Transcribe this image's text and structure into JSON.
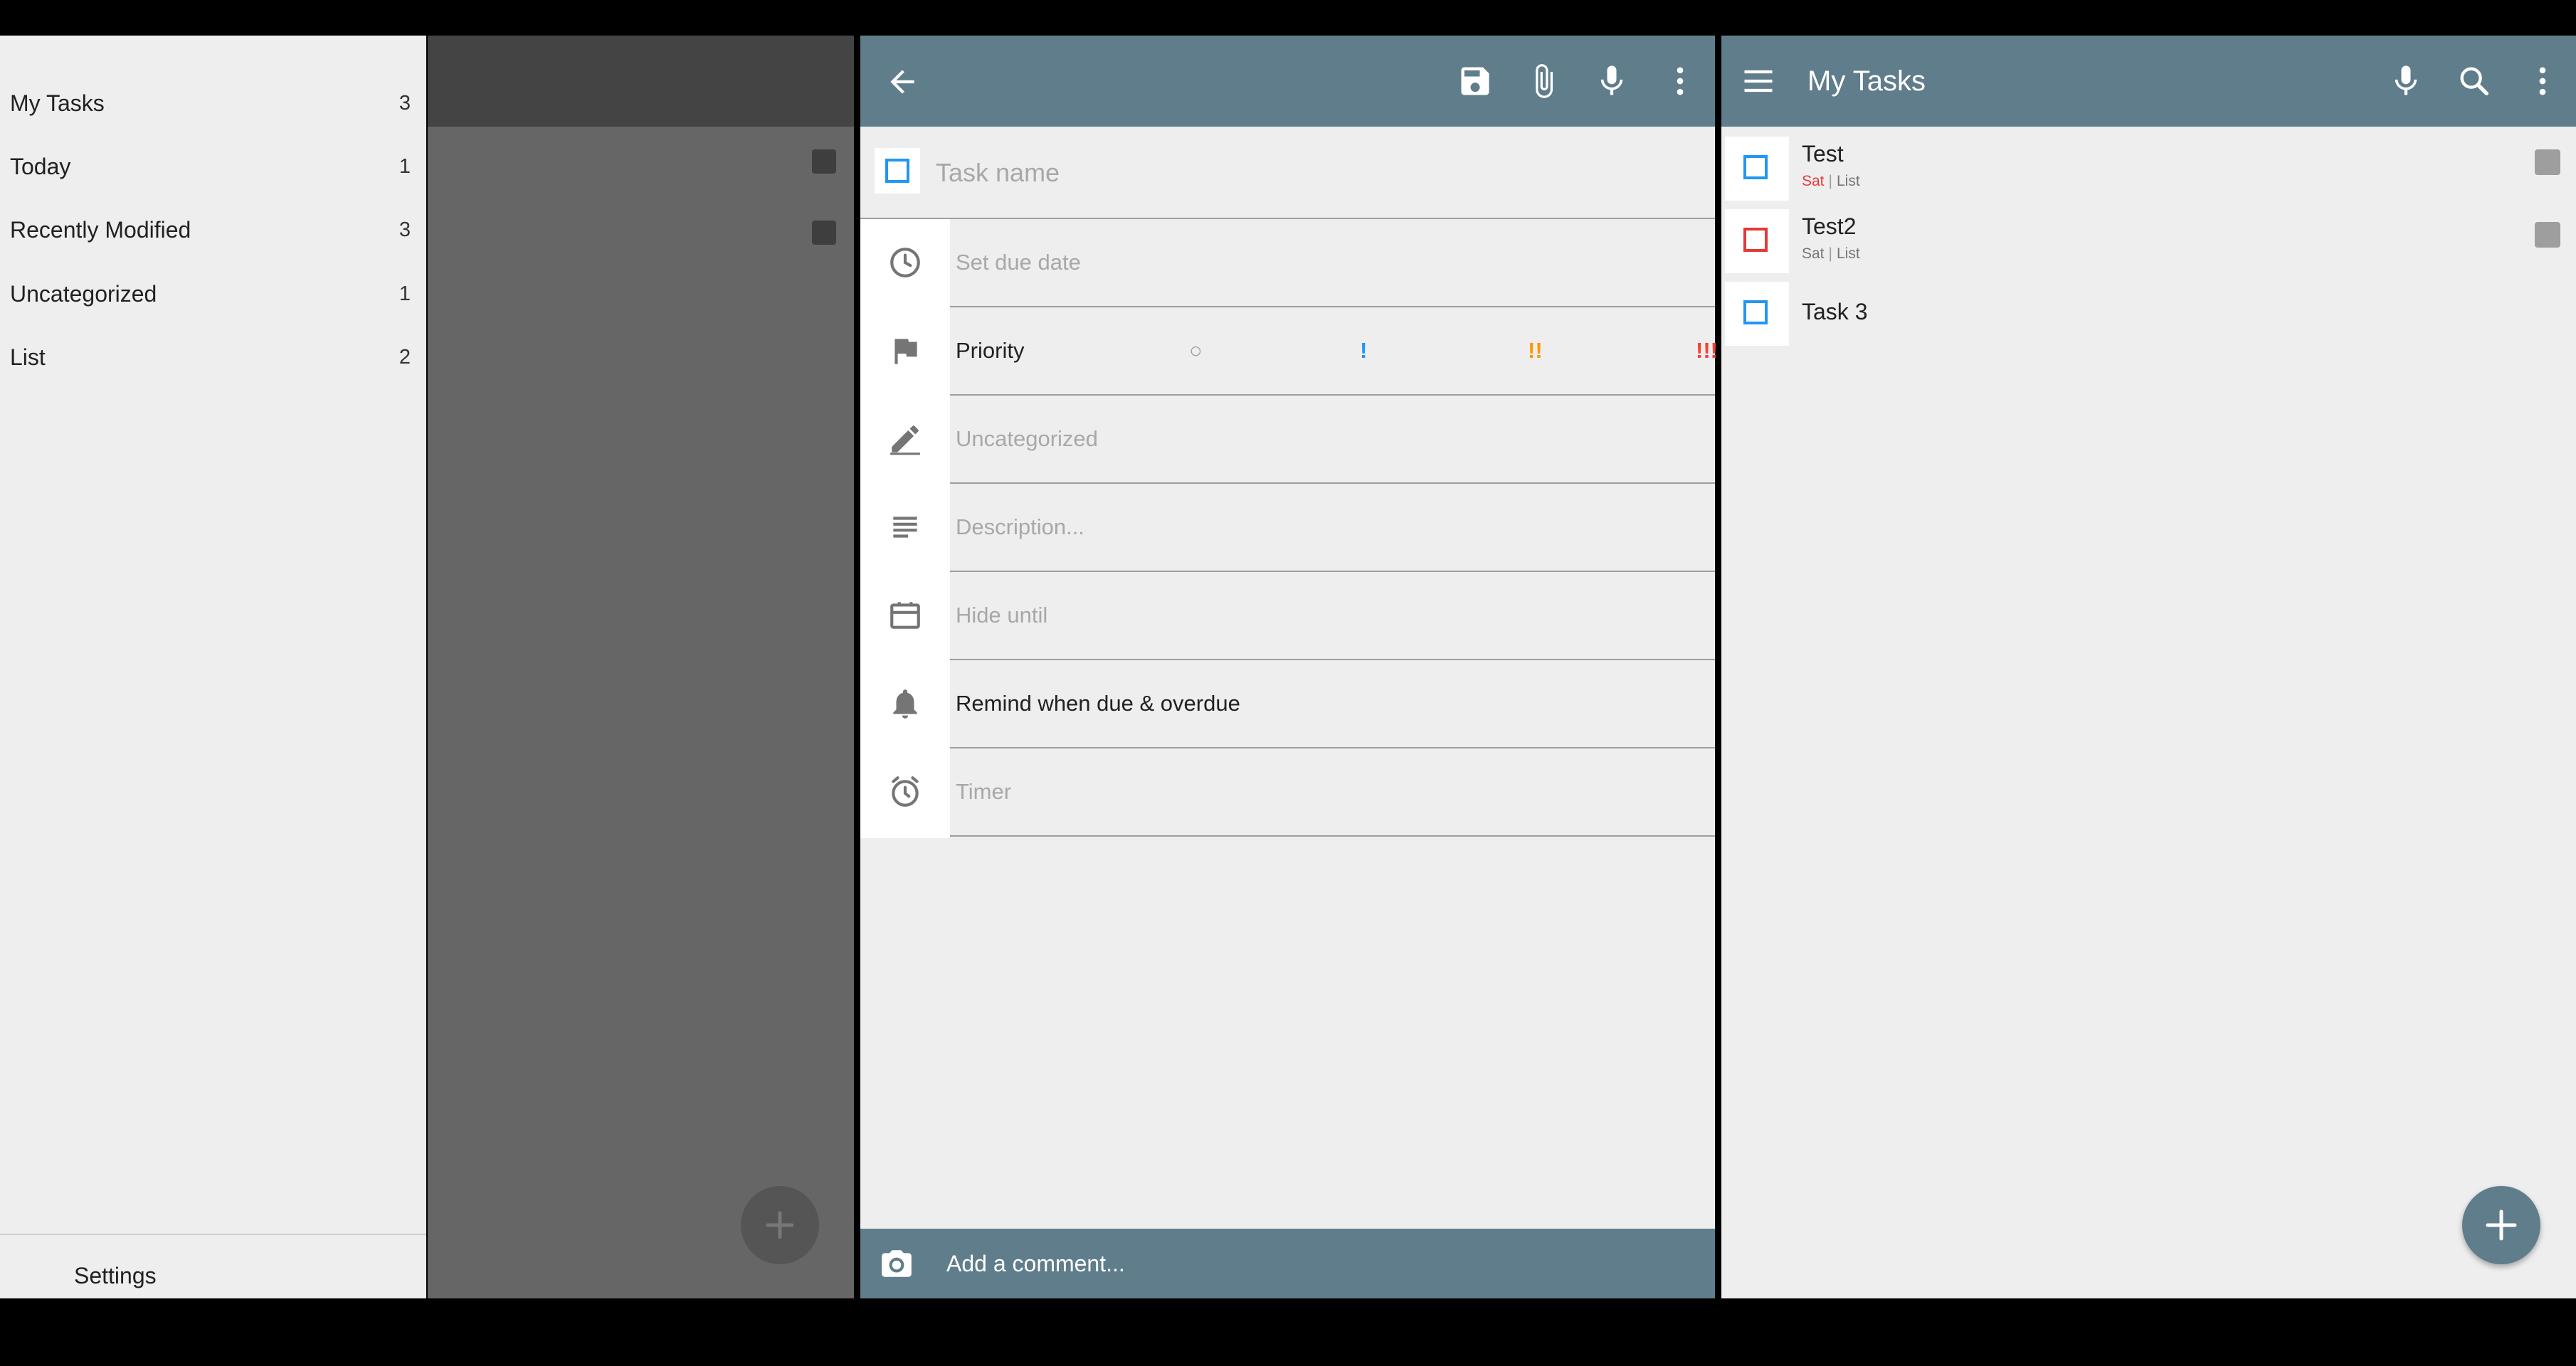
{
  "drawer": {
    "items": [
      {
        "label": "My Tasks",
        "count": "3"
      },
      {
        "label": "Today",
        "count": "1"
      },
      {
        "label": "Recently Modified",
        "count": "3"
      },
      {
        "label": "Uncategorized",
        "count": "1"
      },
      {
        "label": "List",
        "count": "2"
      }
    ],
    "settings_label": "Settings"
  },
  "editor": {
    "toolbar": {
      "icons": [
        "back-arrow-icon",
        "save-icon",
        "attach-icon",
        "mic-icon",
        "more-vert-icon"
      ]
    },
    "task_name_placeholder": "Task name",
    "due_date_placeholder": "Set due date",
    "priority_label": "Priority",
    "priority_options": [
      "○",
      "!",
      "!!",
      "!!!"
    ],
    "priority_colors": [
      "#9e9e9e",
      "#2196f3",
      "#ff9800",
      "#f44336"
    ],
    "category_placeholder": "Uncategorized",
    "description_placeholder": "Description...",
    "hide_until_placeholder": "Hide until",
    "reminder_label": "Remind when due & overdue",
    "timer_placeholder": "Timer",
    "comment_placeholder": "Add a comment..."
  },
  "list": {
    "title": "My Tasks",
    "tasks": [
      {
        "title": "Test",
        "due": "Sat",
        "list": "List",
        "checkbox_color": "#2196f3"
      },
      {
        "title": "Test2",
        "due": "Sat",
        "list": "List",
        "checkbox_color": "#e53935"
      },
      {
        "title": "Task 3",
        "checkbox_color": "#2196f3"
      }
    ],
    "toolbar_icons": [
      "menu-icon",
      "mic-icon",
      "search-icon",
      "more-vert-icon"
    ]
  },
  "colors": {
    "toolbar": "#607d8b",
    "background": "#eeeeee",
    "due_text": "#e53935"
  }
}
